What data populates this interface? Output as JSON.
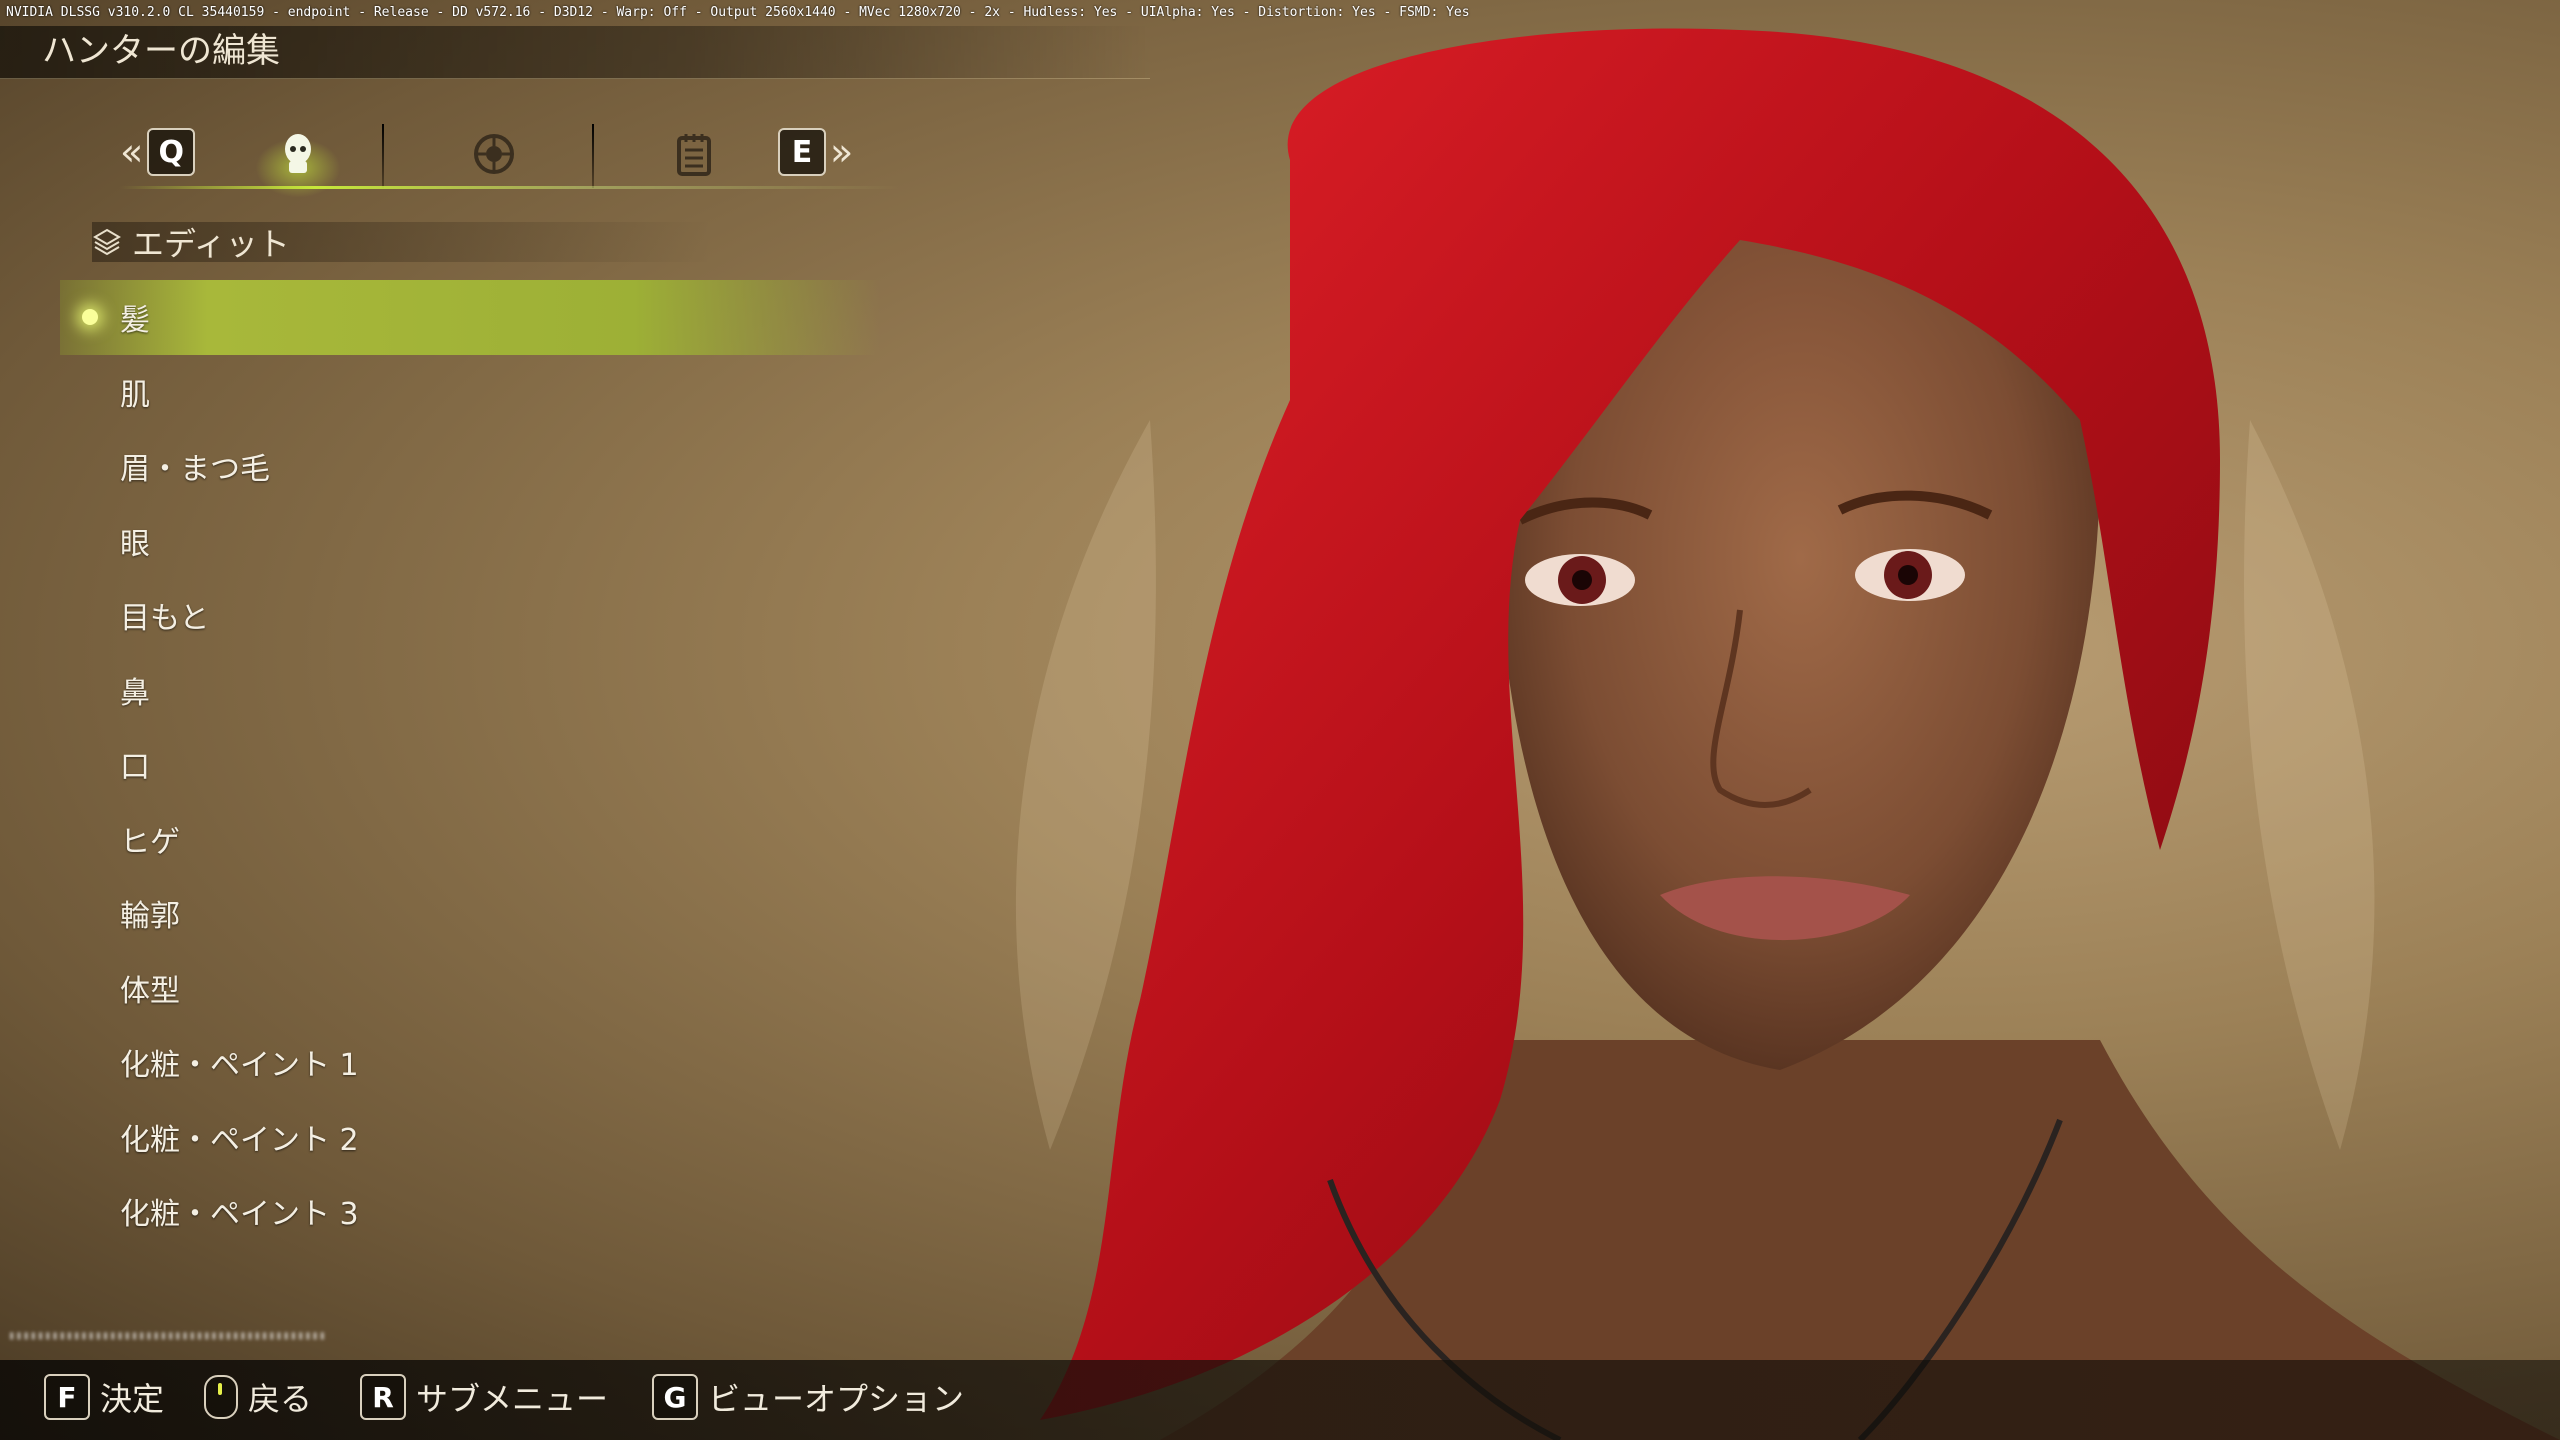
{
  "debug_text": "NVIDIA DLSSG v310.2.0 CL 35440159 - endpoint - Release - DD v572.16 - D3D12 - Warp: Off - Output 2560x1440 - MVec 1280x720 - 2x - Hudless: Yes - UIAlpha: Yes - Distortion: Yes - FSMD: Yes",
  "header": {
    "title": "ハンターの編集"
  },
  "tabs": {
    "prev_key": "Q",
    "next_key": "E",
    "prev_chevron": "«",
    "next_chevron": "»",
    "items": [
      {
        "icon": "head-silhouette-icon",
        "active": true
      },
      {
        "icon": "armor-wheel-icon",
        "active": false
      },
      {
        "icon": "notepad-icon",
        "active": false
      }
    ]
  },
  "section": {
    "label": "エディット"
  },
  "menu": {
    "selected_index": 0,
    "items": [
      "髪",
      "肌",
      "眉・まつ毛",
      "眼",
      "目もと",
      "鼻",
      "口",
      "ヒゲ",
      "輪郭",
      "体型",
      "化粧・ペイント 1",
      "化粧・ペイント 2",
      "化粧・ペイント 3"
    ]
  },
  "footer": {
    "confirm": {
      "key": "F",
      "label": "決定"
    },
    "back": {
      "label": "戻る"
    },
    "submenu": {
      "key": "R",
      "label": "サブメニュー"
    },
    "view": {
      "key": "G",
      "label": "ビューオプション"
    }
  },
  "colors": {
    "accent": "#c7e83a",
    "selected_bg": "#a8b83a",
    "hair": "#c8141a",
    "skin": "#8a5a3e"
  }
}
